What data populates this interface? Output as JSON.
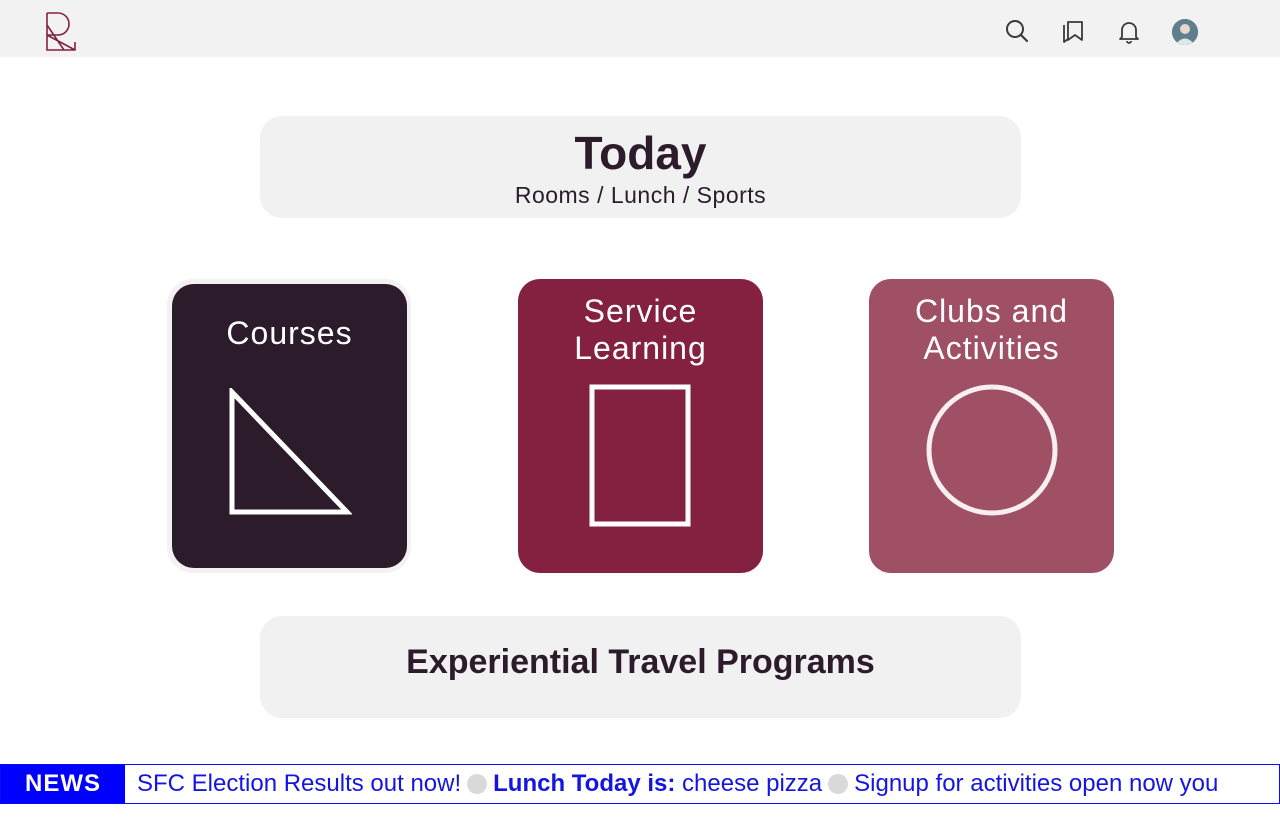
{
  "header": {
    "logo_icon": "rl-monogram-logo",
    "icons": [
      "search-icon",
      "bookmarks-icon",
      "bell-icon",
      "user-avatar"
    ]
  },
  "today": {
    "title": "Today",
    "subtitle": "Rooms / Lunch / Sports"
  },
  "cards": [
    {
      "label": "Courses",
      "icon": "triangle-icon",
      "color": "#2b1b2b"
    },
    {
      "label_line1": "Service",
      "label_line2": "Learning",
      "icon": "rectangle-icon",
      "color": "#842040"
    },
    {
      "label_line1": "Clubs and",
      "label_line2": "Activities",
      "icon": "circle-icon",
      "color": "#9f5064"
    }
  ],
  "travel": {
    "title": "Experiential Travel Programs"
  },
  "news": {
    "label": "NEWS",
    "item1": "SFC Election Results out now!",
    "item2_bold": "Lunch Today is:",
    "item2_rest": " cheese pizza",
    "item3": "Signup for activities open now you",
    "accent": "#0000ff"
  }
}
